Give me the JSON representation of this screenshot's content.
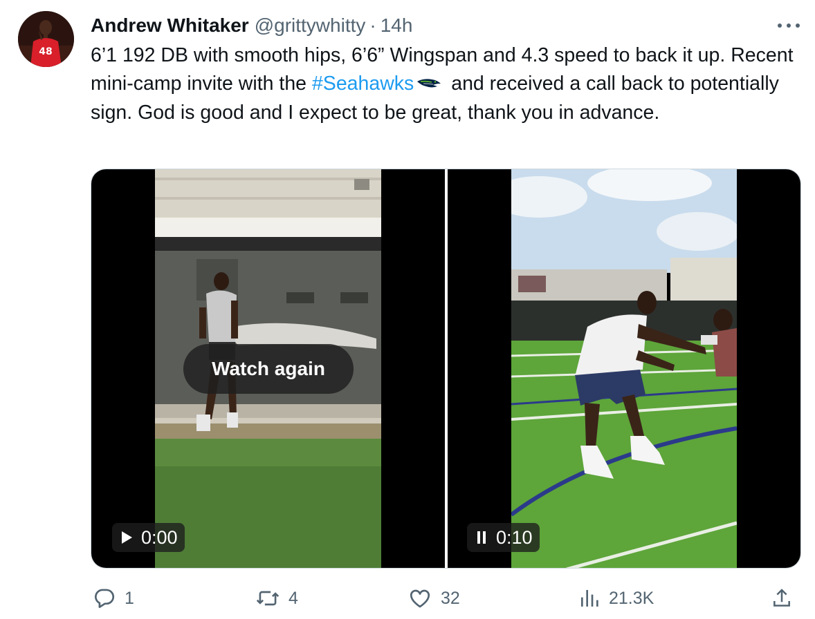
{
  "tweet": {
    "author_name": "Andrew Whitaker",
    "handle": "@grittywhitty",
    "separator": "·",
    "time": "14h",
    "text_before": "6’1 192 DB with smooth hips, 6’6” Wingspan and 4.3 speed to back it up. Recent mini-camp invite with the ",
    "hashtag": "#Seahawks",
    "text_after": " and received a call back to potentially sign. God is good and I expect to be great, thank you in advance."
  },
  "avatar": {
    "jersey_number": "48"
  },
  "media": {
    "video_left": {
      "overlay_label": "Watch again",
      "timestamp": "0:00",
      "control_icon": "play-icon"
    },
    "video_right": {
      "timestamp": "0:10",
      "control_icon": "pause-icon"
    }
  },
  "actions": {
    "replies": "1",
    "reposts": "4",
    "likes": "32",
    "views": "21.3K"
  },
  "colors": {
    "link": "#1d9bf0",
    "secondary_text": "#536471",
    "primary_text": "#0f1419"
  }
}
